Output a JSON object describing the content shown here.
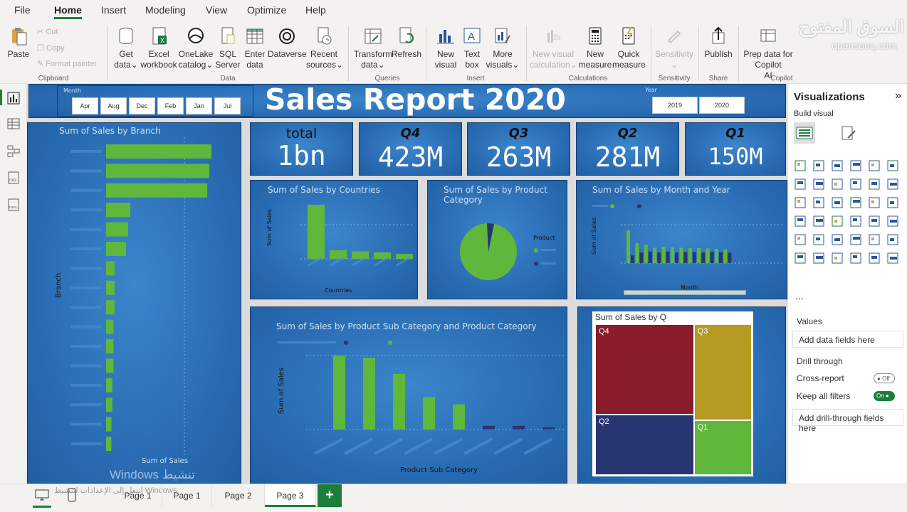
{
  "menu": {
    "tabs": [
      {
        "label": "File"
      },
      {
        "label": "Home"
      },
      {
        "label": "Insert"
      },
      {
        "label": "Modeling"
      },
      {
        "label": "View"
      },
      {
        "label": "Optimize"
      },
      {
        "label": "Help"
      }
    ],
    "active_tab": "Home"
  },
  "ribbon": {
    "paste": "Paste",
    "cut": "Cut",
    "copy": "Copy",
    "format_painter": "Format painter",
    "groups": {
      "clipboard": "Clipboard",
      "data": "Data",
      "queries": "Queries",
      "insert": "Insert",
      "calculations": "Calculations",
      "sensitivity": "Sensitivity",
      "share": "Share",
      "copilot": "Copilot"
    },
    "get_data": [
      "Get",
      "data"
    ],
    "excel": [
      "Excel",
      "workbook"
    ],
    "onelake": [
      "OneLake",
      "catalog"
    ],
    "sql": [
      "SQL",
      "Server"
    ],
    "enter_data": [
      "Enter",
      "data"
    ],
    "dataverse": [
      "Dataverse"
    ],
    "recent_sources": [
      "Recent",
      "sources"
    ],
    "transform_data": [
      "Transform",
      "data"
    ],
    "refresh": [
      "Refresh"
    ],
    "new_visual": [
      "New",
      "visual"
    ],
    "text_box": [
      "Text",
      "box"
    ],
    "more_visuals": [
      "More",
      "visuals"
    ],
    "new_visual_calc": [
      "New visual",
      "calculation"
    ],
    "new_measure": [
      "New",
      "measure"
    ],
    "quick_measure": [
      "Quick",
      "measure"
    ],
    "sensitivity_btn": [
      "Sensitivity"
    ],
    "publish": [
      "Publish"
    ],
    "prep_copilot": [
      "Prep data for Copilot",
      "AI"
    ]
  },
  "brand": {
    "arabic": "السوق المفتوح",
    "latin": "opensooq.com"
  },
  "report": {
    "title": "Sales Report 2020",
    "month_slicer": {
      "label": "Month",
      "options": [
        "Apr",
        "Aug",
        "Dec",
        "Feb",
        "Jan",
        "Jul"
      ]
    },
    "year_slicer": {
      "label": "Year",
      "options": [
        "2019",
        "2020"
      ]
    },
    "kpis": [
      {
        "label": "total",
        "value": "1bn"
      },
      {
        "label": "Q4",
        "value": "423M"
      },
      {
        "label": "Q3",
        "value": "263M"
      },
      {
        "label": "Q2",
        "value": "281M"
      },
      {
        "label": "Q1",
        "value": "150M"
      }
    ],
    "branch_chart": {
      "title": "Sum of Sales by Branch",
      "xlabel": "Sum of Sales",
      "ylabel": "Branch"
    },
    "countries_chart": {
      "title": "Sum of Sales by Countries",
      "xlabel": "Countries",
      "ylabel": "Sum of Sales"
    },
    "category_chart": {
      "title_line1": "Sum of Sales by Product",
      "title_line2": "Category",
      "legend_title": "Product"
    },
    "month_chart": {
      "title": "Sum of Sales by Month and Year",
      "xlabel": "Month",
      "ylabel": "Sum of Sales"
    },
    "subcat_chart": {
      "title": "Sum of Sales by Product Sub Category and Product Category",
      "xlabel": "Product Sub Category",
      "ylabel": "Sum of Sales"
    },
    "q_chart": {
      "title": "Sum of Sales by Q"
    },
    "activation_watermark": {
      "line1": "Windows تنشيط",
      "line2": "انتقل إلى الإعدادات لتنشيط Windows"
    }
  },
  "chart_data": [
    {
      "type": "bar",
      "orientation": "horizontal",
      "title": "Sum of Sales by Branch",
      "xlabel": "Sum of Sales",
      "ylabel": "Branch",
      "values": [
        100,
        98,
        96,
        23,
        21,
        19,
        8,
        8,
        8,
        7,
        7,
        7,
        6,
        6,
        5,
        5
      ]
    },
    {
      "type": "bar",
      "title": "Sum of Sales by Countries",
      "xlabel": "Countries",
      "ylabel": "Sum of Sales",
      "values": [
        100,
        16,
        14,
        12,
        9,
        5
      ]
    },
    {
      "type": "pie",
      "title": "Sum of Sales by Product Category",
      "values": [
        96,
        4
      ],
      "colors": [
        "#5fb83c",
        "#2a3570"
      ]
    },
    {
      "type": "bar",
      "title": "Sum of Sales by Month and Year",
      "xlabel": "Month",
      "ylabel": "Sum of Sales",
      "series": [
        {
          "color": "#5fb83c",
          "values": [
            85,
            52,
            48,
            40,
            42,
            41,
            40,
            39,
            39,
            38,
            37,
            36
          ]
        },
        {
          "color": "#2a3570",
          "values": [
            20,
            28,
            30,
            28,
            30,
            28,
            29,
            29,
            28,
            29,
            28,
            27
          ]
        }
      ]
    },
    {
      "type": "bar",
      "title": "Sum of Sales by Product Sub Category and Product Category",
      "xlabel": "Product Sub Category",
      "ylabel": "Sum of Sales",
      "series": [
        {
          "color": "#5fb83c",
          "values": [
            100,
            97,
            75,
            44,
            34,
            0,
            0,
            0
          ]
        },
        {
          "color": "#2a3570",
          "values": [
            0,
            0,
            0,
            0,
            0,
            5,
            5,
            3
          ]
        }
      ]
    },
    {
      "type": "treemap",
      "title": "Sum of Sales by Q",
      "categories": [
        "Q4",
        "Q3",
        "Q2",
        "Q1"
      ],
      "values": [
        423,
        263,
        281,
        150
      ],
      "colors": [
        "#8b1c2b",
        "#b59a21",
        "#283670",
        "#5fb83c"
      ]
    }
  ],
  "vispane": {
    "title": "Visualizations",
    "build_visual": "Build visual",
    "values": "Values",
    "add_data_fields": "Add data fields here",
    "drill_through": "Drill through",
    "cross_report": "Cross-report",
    "cross_report_state": "Off",
    "keep_all_filters": "Keep all filters",
    "keep_all_filters_state": "On",
    "add_drill_fields": "Add drill-through fields here",
    "more": "..."
  },
  "pages": [
    {
      "label": "Page 1"
    },
    {
      "label": "Page 1"
    },
    {
      "label": "Page 2"
    },
    {
      "label": "Page 3"
    }
  ],
  "active_page": "Page 3",
  "add_page": "+"
}
